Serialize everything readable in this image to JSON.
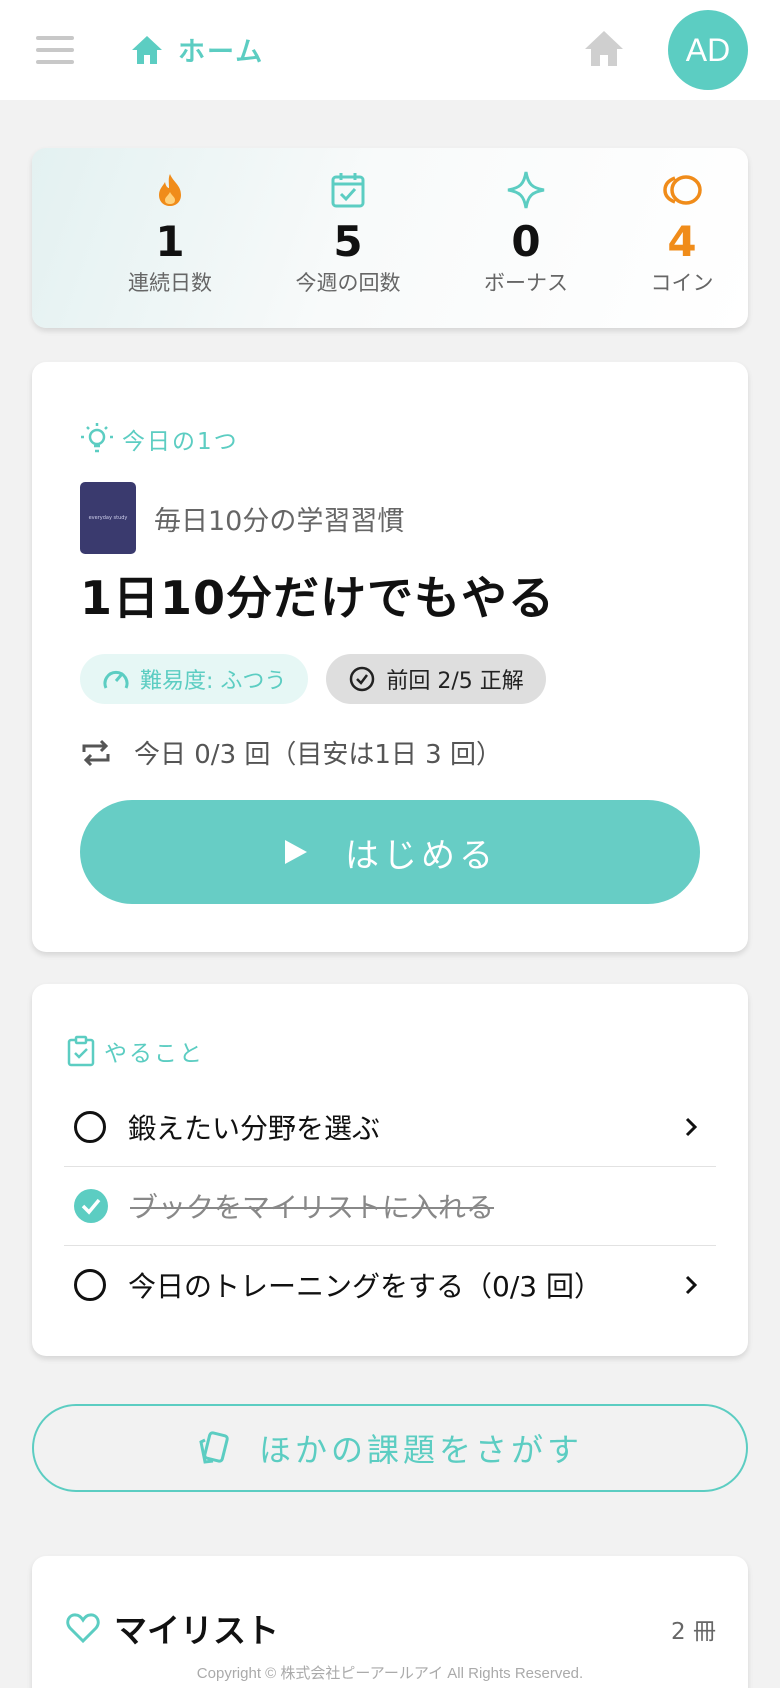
{
  "header": {
    "home_label": "ホーム",
    "avatar_initials": "AD"
  },
  "stats": [
    {
      "icon": "flame-icon",
      "value": "1",
      "label": "連続日数",
      "color": "#f08c1a"
    },
    {
      "icon": "calendar-check-icon",
      "value": "5",
      "label": "今週の回数",
      "color": "#5ccdc2"
    },
    {
      "icon": "sparkle-icon",
      "value": "0",
      "label": "ボーナス",
      "color": "#5ccdc2"
    },
    {
      "icon": "coin-icon",
      "value": "4",
      "label": "コイン",
      "color": "#f08c1a"
    }
  ],
  "today": {
    "section_title": "今日の1つ",
    "book_cover_text": "everyday study",
    "book_title": "毎日10分の学習習慣",
    "headline": "1日10分だけでもやる",
    "difficulty_chip": "難易度: ふつう",
    "last_result_chip": "前回 2/5 正解",
    "repeat_text": "今日 0/3 回（目安は1日 3 回）",
    "start_button": "はじめる"
  },
  "todo": {
    "section_title": "やること",
    "items": [
      {
        "label": "鍛えたい分野を選ぶ",
        "done": false
      },
      {
        "label": "ブックをマイリストに入れる",
        "done": true
      },
      {
        "label": "今日のトレーニングをする（0/3 回）",
        "done": false
      }
    ]
  },
  "other_button": "ほかの課題をさがす",
  "mylist": {
    "title": "マイリスト",
    "count": "2 冊"
  },
  "footer": "Copyright © 株式会社ピーアールアイ All Rights Reserved.",
  "colors": {
    "accent": "#5ccdc2",
    "orange": "#f08c1a"
  }
}
